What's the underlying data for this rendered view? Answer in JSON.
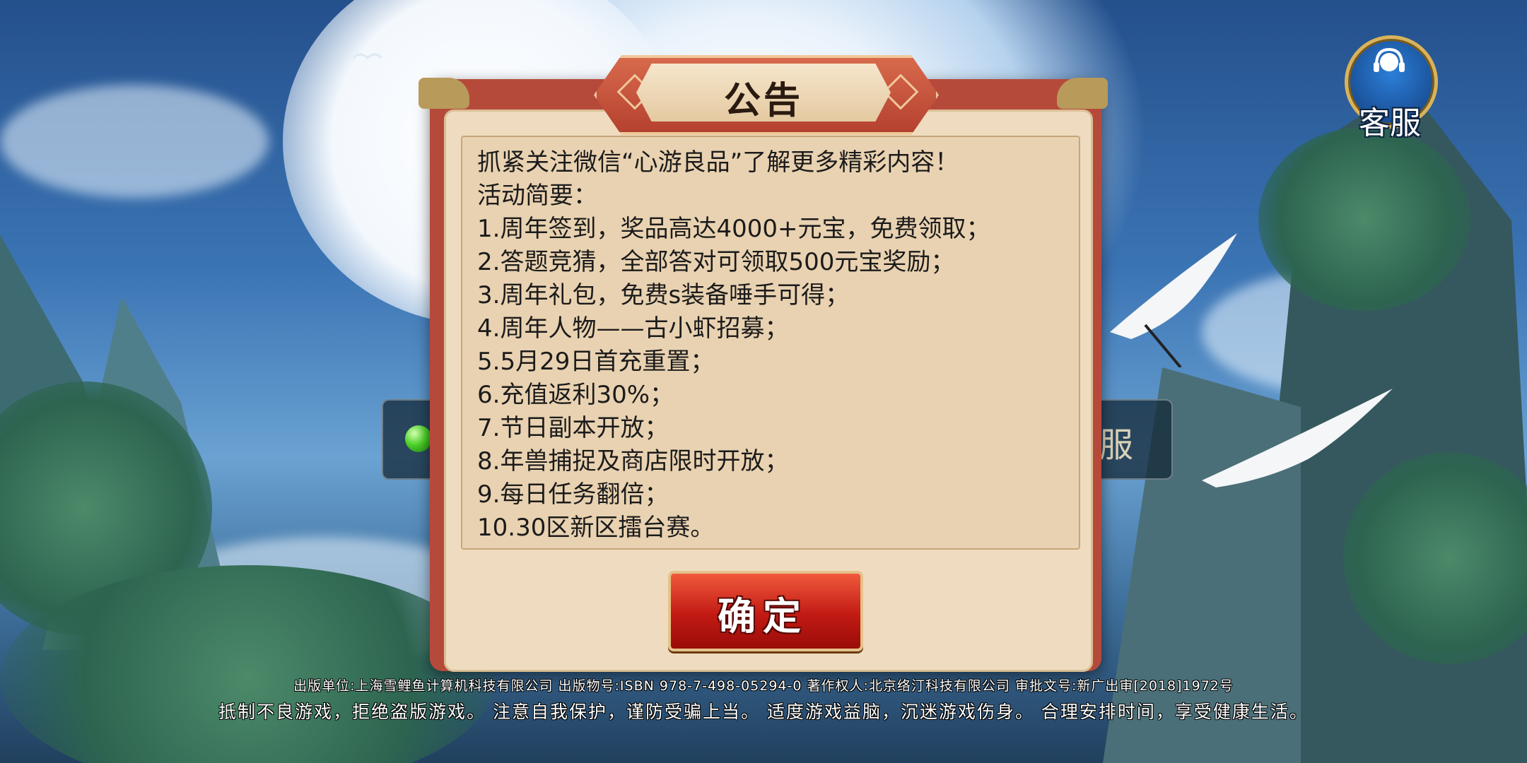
{
  "dialog": {
    "title": "公告",
    "lines": [
      "抓紧关注微信“心游良品”了解更多精彩内容！",
      "活动简要：",
      "1.周年签到，奖品高达4000+元宝，免费领取；",
      "2.答题竞猜，全部答对可领取500元宝奖励；",
      "3.周年礼包，免费s装备唾手可得；",
      "4.周年人物——古小虾招募；",
      "5.5月29日首充重置；",
      "6.充值返利30%；",
      "7.节日副本开放；",
      "8.年兽捕捉及商店限时开放；",
      "9.每日任务翻倍；",
      "10.30区新区擂台赛。"
    ],
    "confirm_label": "确定"
  },
  "customer_service": {
    "label": "客服",
    "icon": "headset-icon"
  },
  "behind": {
    "right_text": "服"
  },
  "footer": {
    "line1": "出版单位:上海雪鲤鱼计算机科技有限公司 出版物号:ISBN 978-7-498-05294-0 著作权人:北京络汀科技有限公司 审批文号:新广出审[2018]1972号",
    "line2": "抵制不良游戏，拒绝盗版游戏。 注意自我保护，谨防受骗上当。 适度游戏益脑，沉迷游戏伤身。 合理安排时间，享受健康生活。"
  },
  "colors": {
    "dialog_frame": "#b64a3a",
    "panel": "#e9d2b1",
    "confirm": "#c21a14",
    "cs_ring": "#d9b35a"
  }
}
